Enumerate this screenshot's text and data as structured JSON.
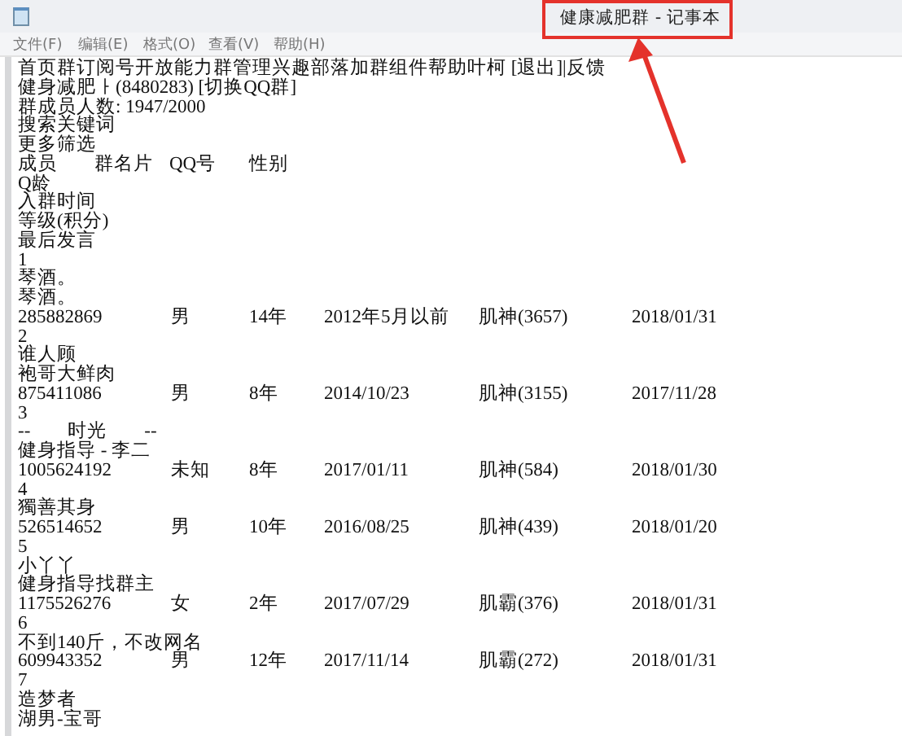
{
  "window": {
    "title": "健康减肥群 - 记事本"
  },
  "menu": [
    "文件(F)",
    "编辑(E)",
    "格式(O)",
    "查看(V)",
    "帮助(H)"
  ],
  "lines": [
    {
      "kind": "text",
      "text": "首页群订阅号开放能力群管理兴趣部落加群组件帮助叶柯 [退出]|反馈"
    },
    {
      "kind": "text",
      "text": "健身减肥ㅏ(8480283) [切换QQ群]"
    },
    {
      "kind": "text",
      "text": "群成员人数: 1947/2000"
    },
    {
      "kind": "text",
      "text": "搜索关键词"
    },
    {
      "kind": "text",
      "text": "更多筛选"
    },
    {
      "kind": "header",
      "cells": [
        "成员",
        "群名片",
        "QQ号",
        "性别"
      ]
    },
    {
      "kind": "text",
      "text": "Q龄"
    },
    {
      "kind": "text",
      "text": "入群时间"
    },
    {
      "kind": "text",
      "text": "等级(积分)"
    },
    {
      "kind": "text",
      "text": "最后发言"
    },
    {
      "kind": "text",
      "text": "1"
    },
    {
      "kind": "text",
      "text": "琴酒。"
    },
    {
      "kind": "text",
      "text": "琴酒。"
    },
    {
      "kind": "record",
      "cells": [
        "285882869",
        "男",
        "14年",
        "2012年5月以前",
        "肌神(3657)",
        "2018/01/31"
      ]
    },
    {
      "kind": "text",
      "text": "2"
    },
    {
      "kind": "text",
      "text": "谁人顾"
    },
    {
      "kind": "text",
      "text": "袍哥大鲜肉"
    },
    {
      "kind": "record",
      "cells": [
        "875411086",
        "男",
        "8年",
        "2014/10/23",
        "肌神(3155)",
        "2017/11/28"
      ]
    },
    {
      "kind": "text",
      "text": "3"
    },
    {
      "kind": "text",
      "text": "--        时光        --"
    },
    {
      "kind": "text",
      "text": "健身指导 - 李二"
    },
    {
      "kind": "record",
      "cells": [
        "1005624192",
        "未知",
        "8年",
        "2017/01/11",
        "肌神(584)",
        "2018/01/30"
      ]
    },
    {
      "kind": "text",
      "text": "4"
    },
    {
      "kind": "text",
      "text": "獨善其身"
    },
    {
      "kind": "record",
      "cells": [
        "526514652",
        "男",
        "10年",
        "2016/08/25",
        "肌神(439)",
        "2018/01/20"
      ]
    },
    {
      "kind": "text",
      "text": "5"
    },
    {
      "kind": "text",
      "text": "小丫丫"
    },
    {
      "kind": "text",
      "text": "健身指导找群主"
    },
    {
      "kind": "record",
      "cells": [
        "1175526276",
        "女",
        "2年",
        "2017/07/29",
        "肌霸(376)",
        "2018/01/31"
      ]
    },
    {
      "kind": "text",
      "text": "6"
    },
    {
      "kind": "text",
      "text": "不到140斤，不改网名"
    },
    {
      "kind": "record",
      "cells": [
        "609943352",
        "男",
        "12年",
        "2017/11/14",
        "肌霸(272)",
        "2018/01/31"
      ]
    },
    {
      "kind": "text",
      "text": "7"
    },
    {
      "kind": "text",
      "text": "造梦者"
    },
    {
      "kind": "text",
      "text": "湖男-宝哥"
    }
  ]
}
